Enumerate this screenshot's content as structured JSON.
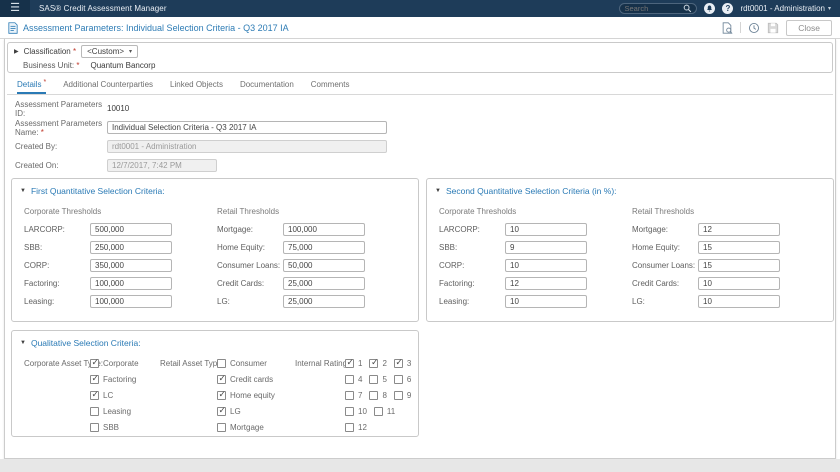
{
  "colors": {
    "topbar": "#1e3c59",
    "accent_blue": "#2a7ab5",
    "required_red": "#c0392b"
  },
  "topbar": {
    "app_title": "SAS® Credit Assessment Manager",
    "search_placeholder": "Search",
    "user": "rdt0001 - Administration"
  },
  "header": {
    "title": "Assessment Parameters: Individual Selection Criteria - Q3 2017 IA",
    "close_label": "Close"
  },
  "classification": {
    "label": "Classification",
    "required_mark": "*",
    "value": "<Custom>",
    "business_unit_label": "Business Unit: ",
    "business_unit_required": "*",
    "business_unit_value": "Quantum Bancorp"
  },
  "tabs": {
    "details": "Details",
    "details_required": "*",
    "additional": "Additional Counterparties",
    "linked": "Linked Objects",
    "documentation": "Documentation",
    "comments": "Comments"
  },
  "form": {
    "id_label": "Assessment Parameters ID:",
    "id_value": "10010",
    "name_label": "Assessment Parameters Name: ",
    "name_required": "*",
    "name_value": "Individual Selection Criteria - Q3 2017 IA",
    "created_by_label": "Created By:",
    "created_by_value": "rdt0001 - Administration",
    "created_on_label": "Created On:",
    "created_on_value": "12/7/2017, 7:42 PM"
  },
  "first_quant": {
    "title": "First Quantitative Selection Criteria:",
    "corporate_header": "Corporate Thresholds",
    "retail_header": "Retail Thresholds",
    "corporate": [
      {
        "label": "LARCORP:",
        "value": "500,000"
      },
      {
        "label": "SBB:",
        "value": "250,000"
      },
      {
        "label": "CORP:",
        "value": "350,000"
      },
      {
        "label": "Factoring:",
        "value": "100,000"
      },
      {
        "label": "Leasing:",
        "value": "100,000"
      }
    ],
    "retail": [
      {
        "label": "Mortgage:",
        "value": "100,000"
      },
      {
        "label": "Home Equity:",
        "value": "75,000"
      },
      {
        "label": "Consumer Loans:",
        "value": "50,000"
      },
      {
        "label": "Credit Cards:",
        "value": "25,000"
      },
      {
        "label": "LG:",
        "value": "25,000"
      }
    ]
  },
  "second_quant": {
    "title": "Second Quantitative Selection Criteria (in %):",
    "corporate_header": "Corporate Thresholds",
    "retail_header": "Retail Thresholds",
    "corporate": [
      {
        "label": "LARCORP:",
        "value": "10"
      },
      {
        "label": "SBB:",
        "value": "9"
      },
      {
        "label": "CORP:",
        "value": "10"
      },
      {
        "label": "Factoring:",
        "value": "12"
      },
      {
        "label": "Leasing:",
        "value": "10"
      }
    ],
    "retail": [
      {
        "label": "Mortgage:",
        "value": "12"
      },
      {
        "label": "Home Equity:",
        "value": "15"
      },
      {
        "label": "Consumer Loans:",
        "value": "15"
      },
      {
        "label": "Credit Cards:",
        "value": "10"
      },
      {
        "label": "LG:",
        "value": "10"
      }
    ]
  },
  "qualitative": {
    "title": "Qualitative Selection Criteria:",
    "corporate_label": "Corporate Asset Type:",
    "retail_label": "Retail Asset Type:",
    "rating_label": "Internal Rating:",
    "corporate_options": [
      {
        "label": "Corporate",
        "checked": true
      },
      {
        "label": "Factoring",
        "checked": true
      },
      {
        "label": "LC",
        "checked": true
      },
      {
        "label": "Leasing",
        "checked": false
      },
      {
        "label": "SBB",
        "checked": false
      }
    ],
    "retail_options": [
      {
        "label": "Consumer",
        "checked": false
      },
      {
        "label": "Credit cards",
        "checked": true
      },
      {
        "label": "Home equity",
        "checked": true
      },
      {
        "label": "LG",
        "checked": true
      },
      {
        "label": "Mortgage",
        "checked": false
      }
    ],
    "rating_options": [
      {
        "label": "1",
        "checked": true
      },
      {
        "label": "2",
        "checked": true
      },
      {
        "label": "3",
        "checked": true
      },
      {
        "label": "4",
        "checked": false
      },
      {
        "label": "5",
        "checked": false
      },
      {
        "label": "6",
        "checked": false
      },
      {
        "label": "7",
        "checked": false
      },
      {
        "label": "8",
        "checked": false
      },
      {
        "label": "9",
        "checked": false
      },
      {
        "label": "10",
        "checked": false
      },
      {
        "label": "11",
        "checked": false
      },
      {
        "label": "12",
        "checked": false
      }
    ]
  }
}
